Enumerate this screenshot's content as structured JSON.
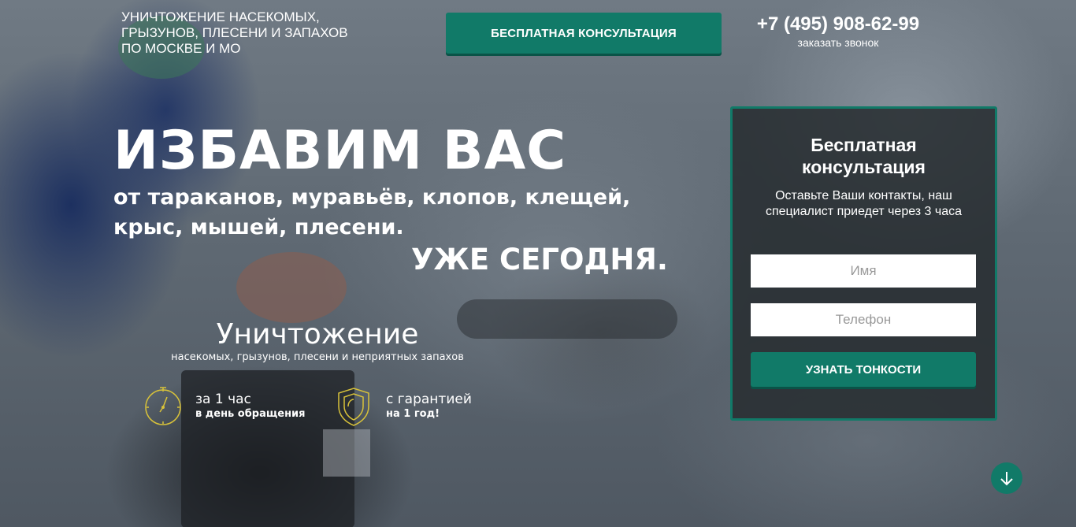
{
  "header": {
    "tagline": [
      "УНИЧТОЖЕНИЕ НАСЕКОМЫХ,",
      "ГРЫЗУНОВ, ПЛЕСЕНИ И ЗАПАХОВ",
      "ПО МОСКВЕ И МО"
    ],
    "consult_button": "БЕСПЛАТНАЯ КОНСУЛЬТАЦИЯ",
    "phone": "+7 (495) 908-62-99",
    "callback_link": "заказать звонок"
  },
  "hero": {
    "title": "ИЗБАВИМ ВАС",
    "subtitle_lines": [
      "от тараканов, муравьёв, клопов, клещей,",
      "крыс, мышей, плесени."
    ],
    "today": "УЖЕ СЕГОДНЯ."
  },
  "service": {
    "title": "Уничтожение",
    "subtitle": "насекомых, грызунов, плесени и неприятных запахов"
  },
  "features": [
    {
      "icon": "stopwatch-icon",
      "title": "за 1 час",
      "subtitle": "в день обращения"
    },
    {
      "icon": "shield-icon",
      "title": "с гарантией",
      "subtitle": "на 1 год!"
    }
  ],
  "form": {
    "title_lines": [
      "Бесплатная",
      "консультация"
    ],
    "description": "Оставьте Ваши контакты, наш специалист приедет через 3 часа",
    "name_placeholder": "Имя",
    "phone_placeholder": "Телефон",
    "submit_label": "УЗНАТЬ ТОНКОСТИ"
  },
  "scroll": {
    "icon": "arrow-down-icon"
  },
  "colors": {
    "accent": "#117a68",
    "accent_dark": "#0a5347",
    "icon_gold": "#d8c23a",
    "form_bg": "#262c30"
  }
}
